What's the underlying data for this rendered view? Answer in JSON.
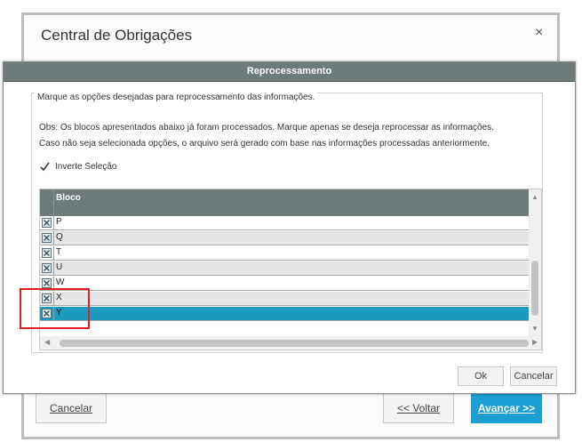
{
  "background_window": {
    "title": "Central de Obrigações",
    "close_glyph": "×",
    "cancel_label": "Cancelar",
    "back_label": "<< Voltar",
    "next_label": "Avançar >>"
  },
  "dialog": {
    "title": "Reprocessamento",
    "group_legend": "Marque as opções desejadas para reprocessamento das informações.",
    "obs_line1": "Obs: Os blocos apresentados abaixo já foram processados. Marque apenas se deseja reprocessar as informações.",
    "obs_line2": "Caso não seja selecionada opções, o arquivo será gerado com base nas informações processadas anteriormente.",
    "invert_selection": {
      "label": "Inverte Seleção",
      "checked": true
    },
    "grid": {
      "column_header": "Bloco",
      "rows": [
        {
          "value": "P",
          "checked": true,
          "selected": false
        },
        {
          "value": "Q",
          "checked": true,
          "selected": false
        },
        {
          "value": "T",
          "checked": true,
          "selected": false
        },
        {
          "value": "U",
          "checked": true,
          "selected": false
        },
        {
          "value": "W",
          "checked": true,
          "selected": false
        },
        {
          "value": "X",
          "checked": true,
          "selected": false
        },
        {
          "value": "Y",
          "checked": true,
          "selected": true
        }
      ]
    },
    "ok_label": "Ok",
    "cancel_label": "Cancelar"
  },
  "colors": {
    "title_bar": "#6d7b7a",
    "selected_row": "#1a9ac0",
    "primary_button": "#1a9ed4",
    "highlight_box": "#e02020"
  }
}
